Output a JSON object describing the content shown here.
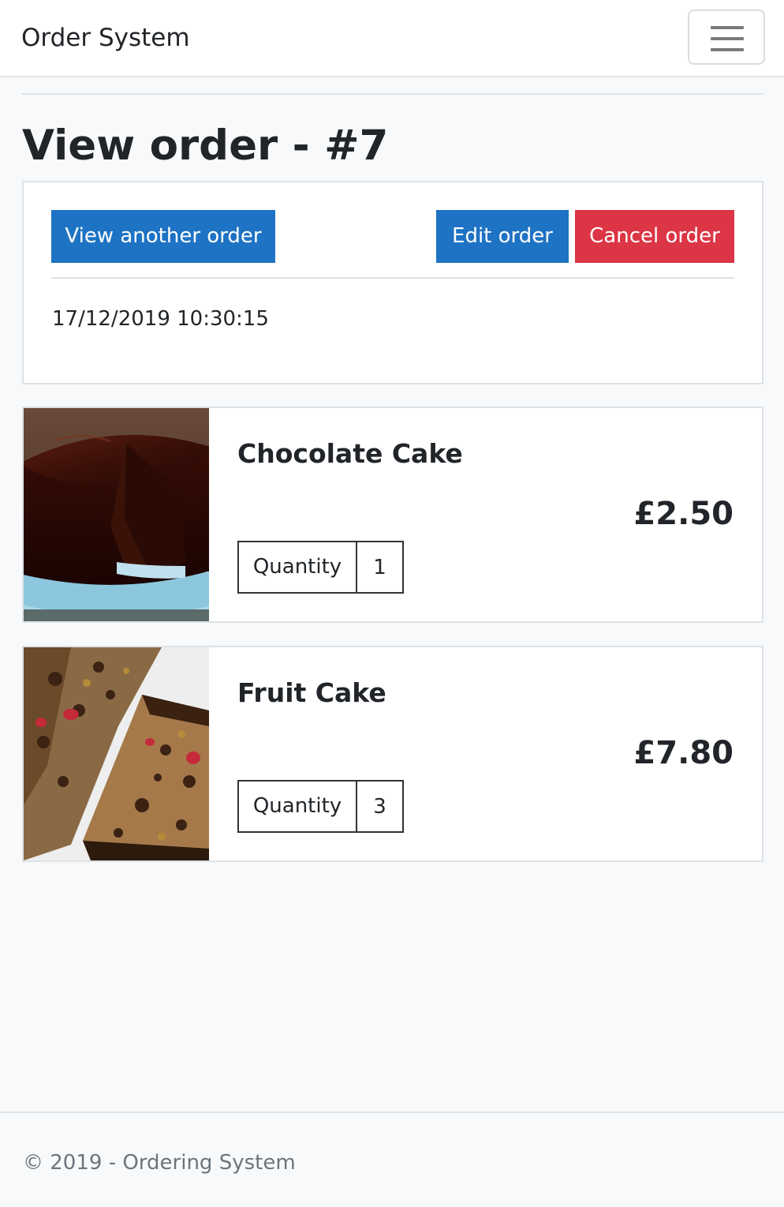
{
  "navbar": {
    "brand": "Order System",
    "menu_icon": "hamburger-menu-icon"
  },
  "page": {
    "title": "View order - #7"
  },
  "order_panel": {
    "view_another_label": "View another order",
    "edit_label": "Edit order",
    "cancel_label": "Cancel order",
    "date": "17/12/2019 10:30:15"
  },
  "items": [
    {
      "name": "Chocolate Cake",
      "price": "£2.50",
      "quantity_label": "Quantity",
      "quantity": "1",
      "image": "chocolate-cake-photo"
    },
    {
      "name": "Fruit Cake",
      "price": "£7.80",
      "quantity_label": "Quantity",
      "quantity": "3",
      "image": "fruit-cake-photo"
    }
  ],
  "footer": {
    "text": "© 2019 - Ordering System"
  },
  "colors": {
    "primary": "#1e73c4",
    "danger": "#dc3545",
    "background": "#f8f9fa",
    "muted": "#6c757d"
  }
}
